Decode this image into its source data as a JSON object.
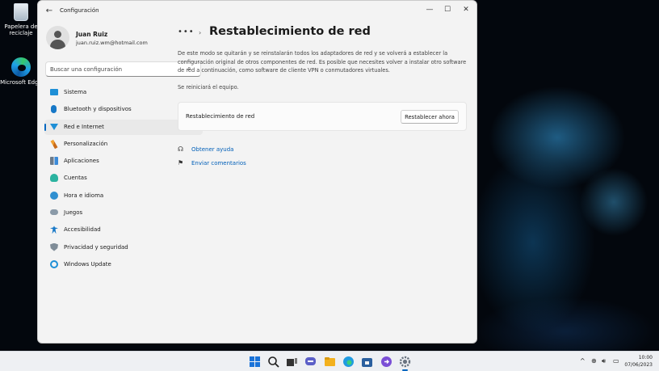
{
  "desktop": {
    "icons": [
      {
        "label": "Papelera de reciclaje",
        "icon": "recycle-bin-icon"
      },
      {
        "label": "Microsoft Edge",
        "icon": "edge-icon"
      }
    ]
  },
  "window": {
    "app_title": "Configuración",
    "controls": {
      "minimize": "—",
      "maximize": "☐",
      "close": "✕"
    }
  },
  "profile": {
    "name": "Juan Ruiz",
    "email": "juan.ruiz.wm@hotmail.com"
  },
  "search": {
    "placeholder": "Buscar una configuración"
  },
  "nav": {
    "selected": "Red e Internet",
    "items": [
      {
        "label": "Sistema",
        "icon": "monitor-icon"
      },
      {
        "label": "Bluetooth y dispositivos",
        "icon": "bluetooth-icon"
      },
      {
        "label": "Red e Internet",
        "icon": "wifi-icon"
      },
      {
        "label": "Personalización",
        "icon": "brush-icon"
      },
      {
        "label": "Aplicaciones",
        "icon": "apps-icon"
      },
      {
        "label": "Cuentas",
        "icon": "person-icon"
      },
      {
        "label": "Hora e idioma",
        "icon": "globe-clock-icon"
      },
      {
        "label": "Juegos",
        "icon": "gamepad-icon"
      },
      {
        "label": "Accesibilidad",
        "icon": "accessibility-icon"
      },
      {
        "label": "Privacidad y seguridad",
        "icon": "shield-icon"
      },
      {
        "label": "Windows Update",
        "icon": "update-icon"
      }
    ]
  },
  "main": {
    "breadcrumb_more": "•••",
    "breadcrumb_sep": "›",
    "title": "Restablecimiento de red",
    "description": "De este modo se quitarán y se reinstalarán todos los adaptadores de red y se volverá a establecer la configuración original de otros componentes de red. Es posible que necesites volver a instalar otro software de red a continuación, como software de cliente VPN o conmutadores virtuales.",
    "restart_note": "Se reiniciará el equipo.",
    "card": {
      "label": "Restablecimiento de red",
      "button": "Restablecer ahora"
    },
    "links": [
      {
        "label": "Obtener ayuda",
        "icon": "help-chat-icon"
      },
      {
        "label": "Enviar comentarios",
        "icon": "feedback-icon"
      }
    ]
  },
  "taskbar": {
    "apps": [
      {
        "name": "start",
        "icon": "windows-start-icon",
        "color": "#1a73d9"
      },
      {
        "name": "search",
        "icon": "search-icon",
        "color": "#222222"
      },
      {
        "name": "task-view",
        "icon": "task-view-icon",
        "color": "#333333"
      },
      {
        "name": "chat",
        "icon": "chat-icon",
        "color": "#5b5fc7"
      },
      {
        "name": "file-explorer",
        "icon": "folder-icon",
        "color": "#f3b11e"
      },
      {
        "name": "edge",
        "icon": "edge-icon",
        "color": "#1f9be0"
      },
      {
        "name": "store",
        "icon": "store-icon",
        "color": "#2a5f9e"
      },
      {
        "name": "app",
        "icon": "purple-app-icon",
        "color": "#7b4fd6"
      },
      {
        "name": "settings",
        "icon": "gear-icon",
        "color": "#6a7480"
      }
    ],
    "tray": {
      "chevron": "^",
      "clock_time": "10:00",
      "clock_date": "07/06/2023"
    }
  }
}
